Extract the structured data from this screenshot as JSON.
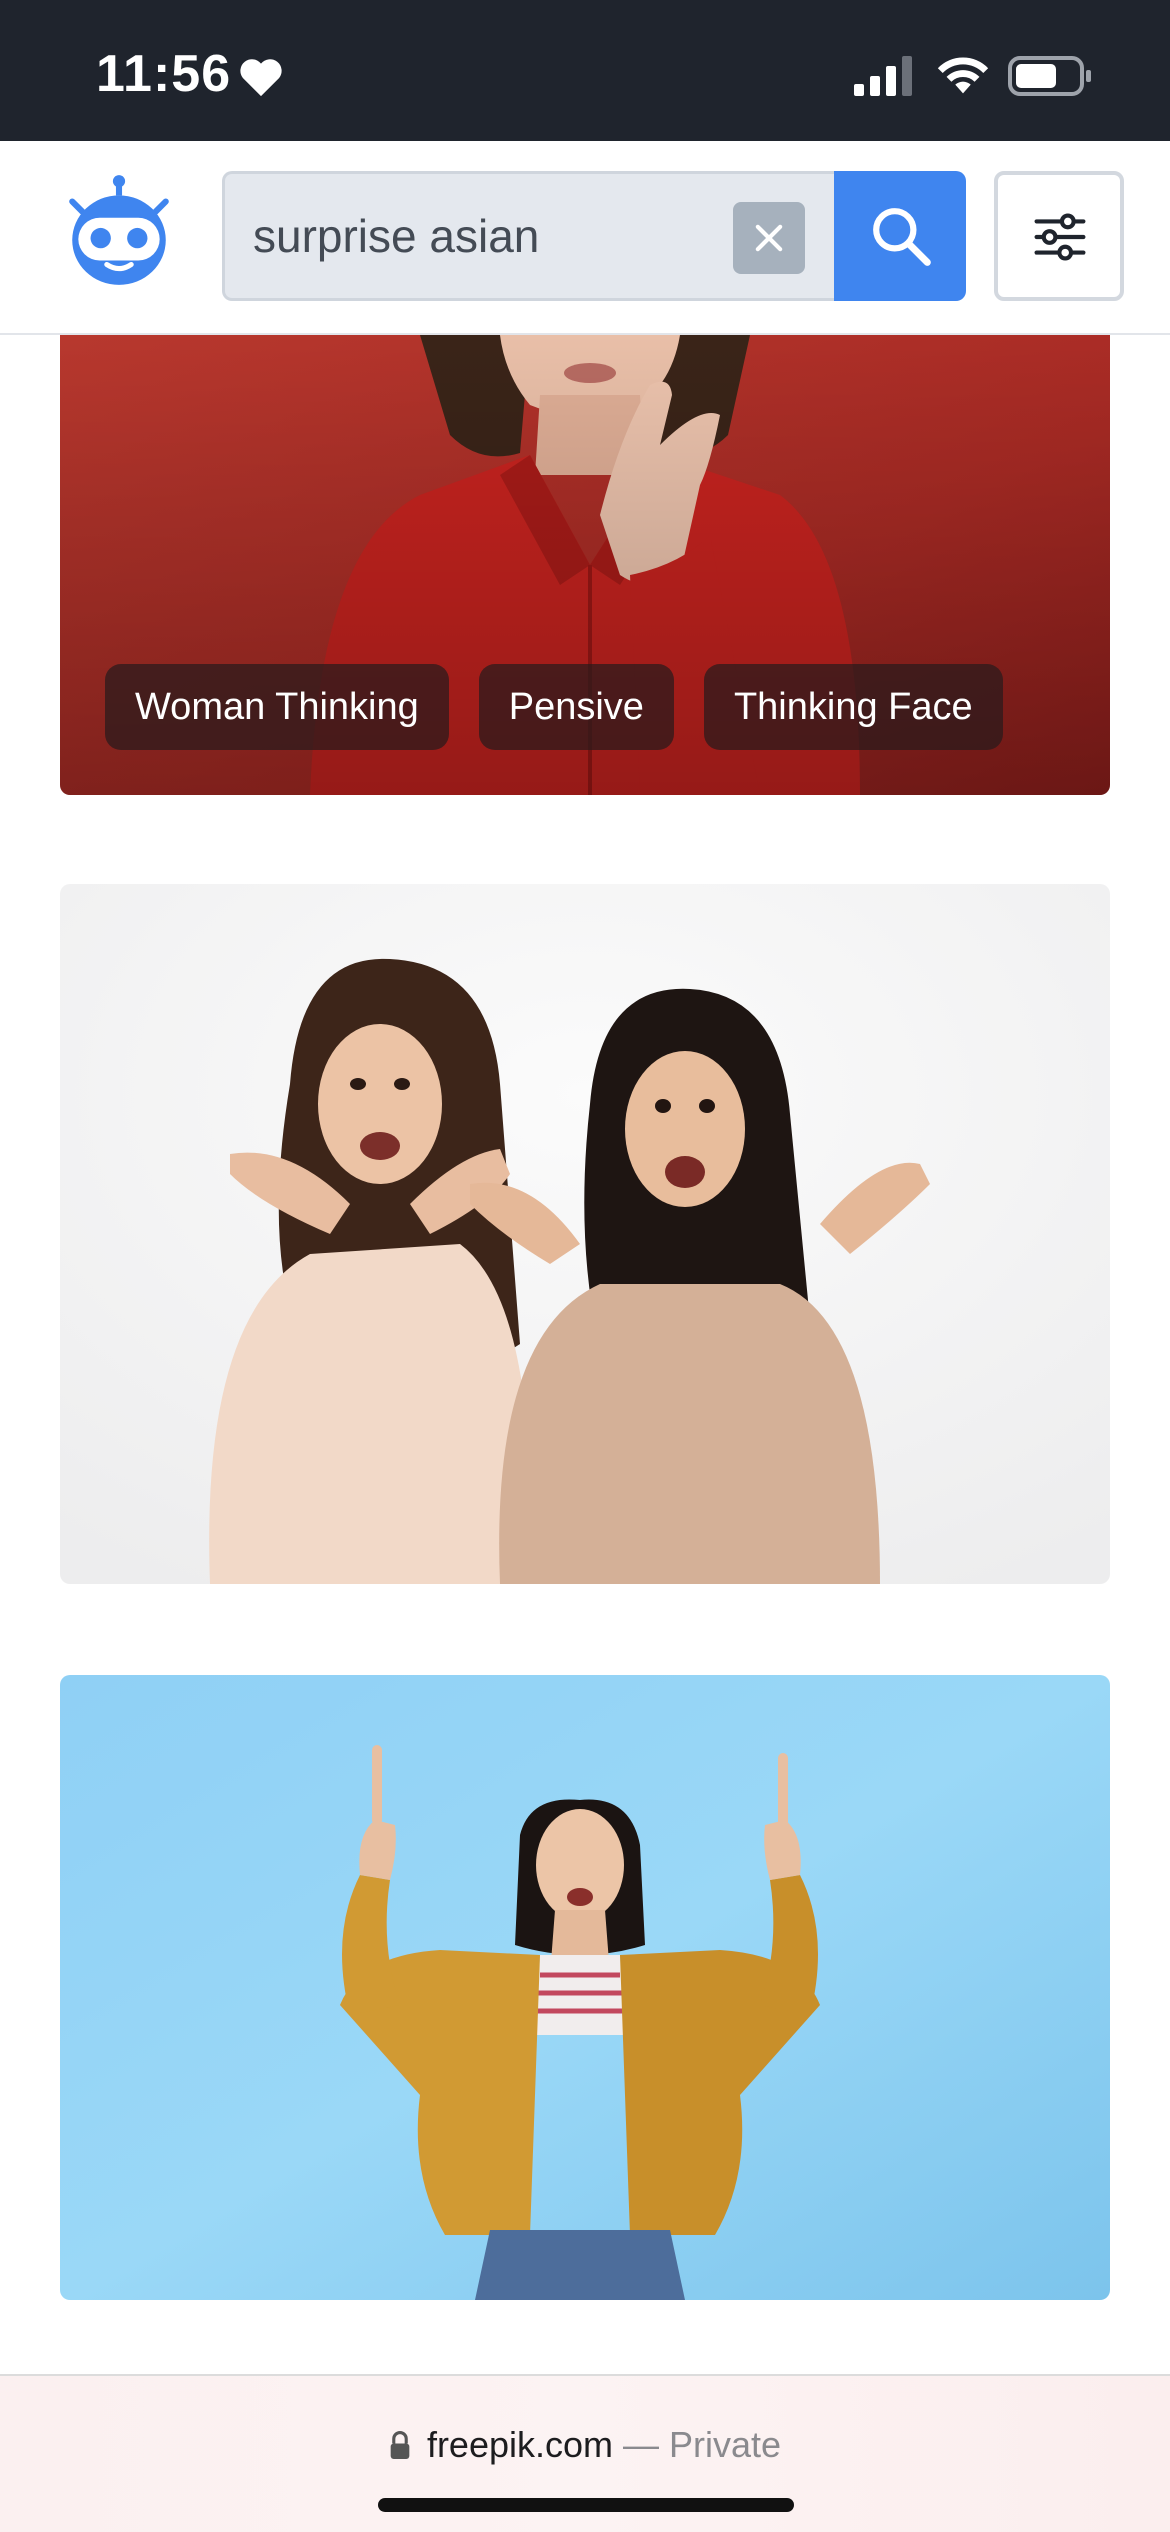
{
  "status_bar": {
    "time": "11:56",
    "icons": [
      "heart-icon",
      "signal-icon",
      "wifi-icon",
      "battery-icon"
    ]
  },
  "header": {
    "logo": "robot-logo-icon",
    "search": {
      "value": "surprise asian",
      "clear_icon": "close-icon",
      "submit_icon": "search-icon"
    },
    "filter_icon": "sliders-icon"
  },
  "results": {
    "cards": [
      {
        "description": "woman in red shirt thinking",
        "tags": [
          "Woman Thinking",
          "Pensive",
          "Thinking Face"
        ]
      },
      {
        "description": "two surprised women"
      },
      {
        "description": "surprised woman pointing up"
      }
    ]
  },
  "browser_bar": {
    "domain": "freepik.com",
    "separator": "—",
    "mode": "Private",
    "lock_icon": "lock-icon"
  },
  "colors": {
    "status_bar_bg": "#1f242d",
    "accent": "#3f85ef",
    "search_bg": "#e4e8ee",
    "tag_bg": "#281a1c"
  }
}
